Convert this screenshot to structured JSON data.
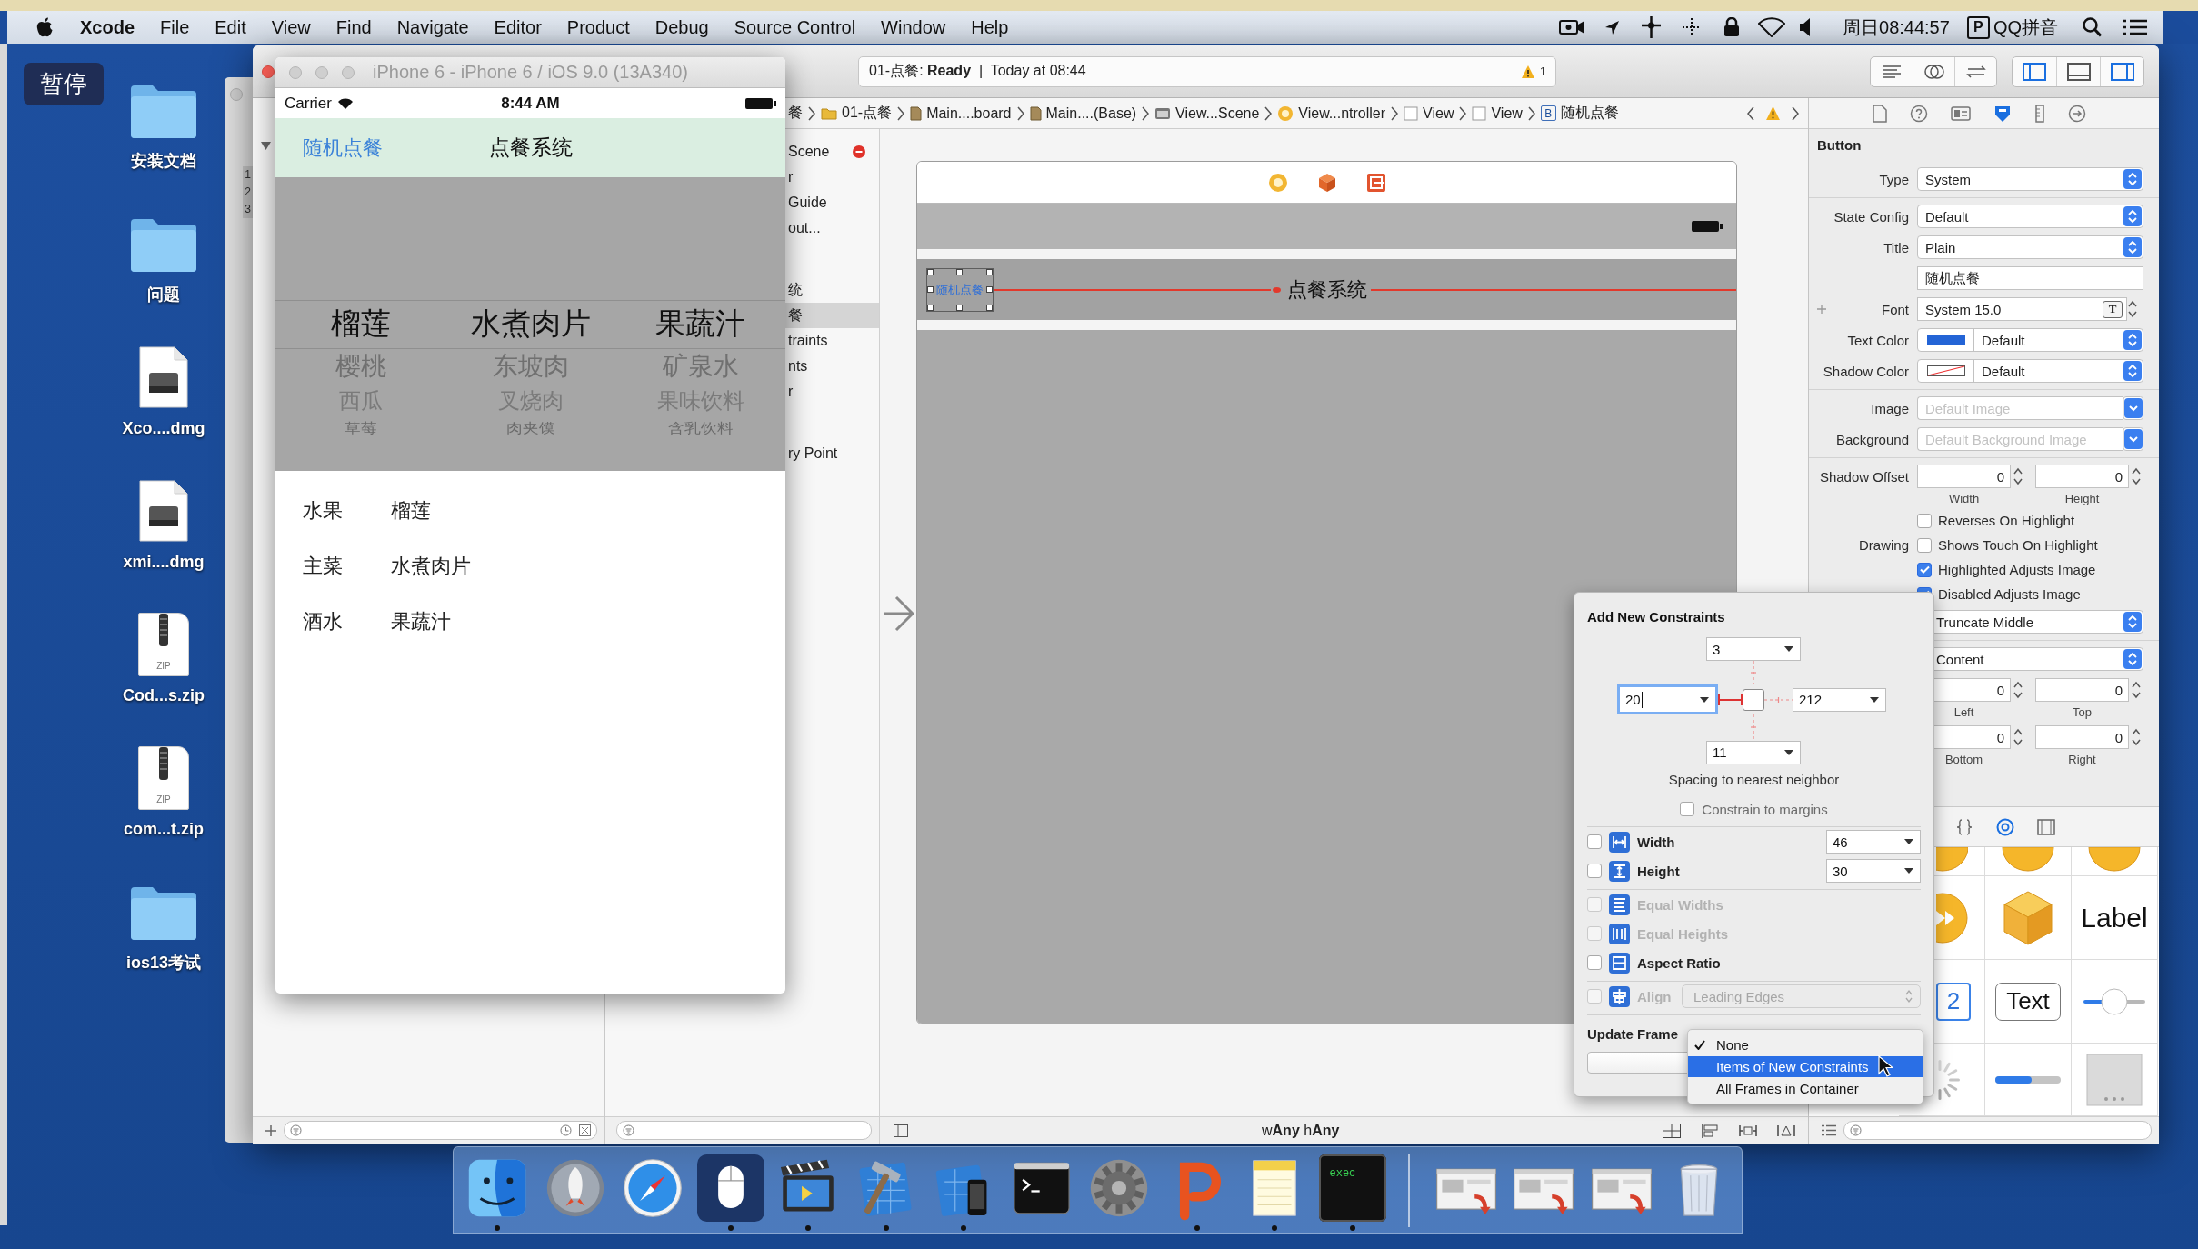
{
  "menu_bar": {
    "app": "Xcode",
    "items": [
      "File",
      "Edit",
      "View",
      "Find",
      "Navigate",
      "Editor",
      "Product",
      "Debug",
      "Source Control",
      "Window",
      "Help"
    ],
    "clock": "周日08:44:57",
    "input_key": "P",
    "input_method": "QQ拼音"
  },
  "pause_badge": "暂停",
  "desktop_icons": [
    {
      "kind": "folder",
      "label": "安装文档"
    },
    {
      "kind": "folder",
      "label": "问题"
    },
    {
      "kind": "disk-image",
      "label": "Xco....dmg"
    },
    {
      "kind": "disk-image",
      "label": "xmi....dmg"
    },
    {
      "kind": "zip",
      "label": "Cod...s.zip",
      "tag": "ZIP"
    },
    {
      "kind": "zip",
      "label": "com...t.zip",
      "tag": "ZIP"
    },
    {
      "kind": "folder",
      "label": "ios13考试"
    }
  ],
  "background_window": {
    "line_numbers": [
      "1",
      "2",
      "3"
    ]
  },
  "simulator": {
    "title": "iPhone 6 - iPhone 6 / iOS 9.0 (13A340)",
    "carrier": "Carrier",
    "time": "8:44 AM",
    "nav_button": "随机点餐",
    "nav_title": "点餐系统",
    "picker": [
      {
        "rows": [
          {
            "label": "榴莲",
            "selected": true
          },
          {
            "label": "樱桃",
            "selected": false
          },
          {
            "label": "西瓜",
            "selected": false
          },
          {
            "label": "草莓",
            "selected": false
          }
        ]
      },
      {
        "rows": [
          {
            "label": "水煮肉片",
            "selected": true
          },
          {
            "label": "东坡肉",
            "selected": false
          },
          {
            "label": "叉烧肉",
            "selected": false
          },
          {
            "label": "肉夹馍",
            "selected": false
          }
        ]
      },
      {
        "rows": [
          {
            "label": "果蔬汁",
            "selected": true
          },
          {
            "label": "矿泉水",
            "selected": false
          },
          {
            "label": "果味饮料",
            "selected": false
          },
          {
            "label": "含乳饮料",
            "selected": false
          }
        ]
      }
    ],
    "results": [
      {
        "category": "水果",
        "choice": "榴莲"
      },
      {
        "category": "主菜",
        "choice": "水煮肉片"
      },
      {
        "category": "酒水",
        "choice": "果蔬汁"
      }
    ]
  },
  "xcode": {
    "status": "01-点餐: **Ready**  |  Today at 08:44",
    "warning_count": "1",
    "view_toggles": [
      {
        "kind": "navigator",
        "on": true
      },
      {
        "kind": "debug",
        "on": false
      },
      {
        "kind": "utilities",
        "on": true
      }
    ],
    "breadcrumb": [
      {
        "kind": "text",
        "label": "餐"
      },
      {
        "kind": "folder",
        "label": "01-点餐"
      },
      {
        "kind": "storyboard",
        "label": "Main....board"
      },
      {
        "kind": "storyboard",
        "label": "Main....(Base)"
      },
      {
        "kind": "scene",
        "label": "View...Scene"
      },
      {
        "kind": "controller",
        "label": "View...ntroller"
      },
      {
        "kind": "view",
        "label": "View"
      },
      {
        "kind": "view",
        "label": "View"
      },
      {
        "kind": "button",
        "badge": "B",
        "label": "随机点餐"
      }
    ],
    "outline": [
      {
        "items": [
          {
            "label": "Scene",
            "error": true,
            "selected": false
          },
          {
            "label": "r",
            "error": false,
            "selected": false
          },
          {
            "label": "Guide",
            "error": false,
            "selected": false
          },
          {
            "label": "out...",
            "error": false,
            "selected": false
          }
        ]
      },
      {
        "items": [
          {
            "label": "统",
            "error": false,
            "selected": false
          },
          {
            "label": "餐",
            "error": false,
            "selected": true
          },
          {
            "label": "traints",
            "error": false,
            "selected": false
          },
          {
            "label": "nts",
            "error": false,
            "selected": false
          },
          {
            "label": "r",
            "error": false,
            "selected": false
          }
        ]
      },
      {
        "items": [
          {
            "label": "ry Point",
            "error": false,
            "selected": false
          }
        ]
      }
    ],
    "canvas": {
      "button_label": "随机点餐",
      "button_selected": true,
      "title_label": "点餐系统",
      "size_class": "w**Any** h**Any**"
    },
    "inspector": {
      "tabs": [
        {
          "kind": "file",
          "selected": false
        },
        {
          "kind": "help",
          "selected": false
        },
        {
          "kind": "identity",
          "selected": false
        },
        {
          "kind": "attributes",
          "selected": true
        },
        {
          "kind": "size",
          "selected": false
        },
        {
          "kind": "connections",
          "selected": false
        }
      ],
      "section": "Button",
      "groups": [
        [
          {
            "kind": "popup",
            "label": "Type",
            "value": "System"
          }
        ],
        [
          {
            "kind": "popup",
            "label": "State Config",
            "value": "Default"
          },
          {
            "kind": "popup",
            "label": "Title",
            "value": "Plain"
          },
          {
            "kind": "text",
            "value": "随机点餐"
          },
          {
            "kind": "font",
            "label": "Font",
            "value": "System 15.0",
            "button": "T"
          },
          {
            "kind": "color",
            "label": "Text Color",
            "value": "Default",
            "color": "#2364d6"
          },
          {
            "kind": "clear-color",
            "label": "Shadow Color",
            "value": "Default"
          }
        ],
        [
          {
            "kind": "combo",
            "label": "Image",
            "placeholder": "Default Image"
          },
          {
            "kind": "combo",
            "label": "Background",
            "placeholder": "Default Background Image"
          }
        ],
        [
          {
            "kind": "pair",
            "label": "Shadow Offset",
            "fields": [
              {
                "value": "0",
                "caption": "Width"
              },
              {
                "value": "0",
                "caption": "Height"
              }
            ]
          },
          {
            "kind": "check",
            "text": "Reverses On Highlight",
            "checked": false
          },
          {
            "kind": "check",
            "label": "Drawing",
            "text": "Shows Touch On Highlight",
            "checked": false
          },
          {
            "kind": "check",
            "text": "Highlighted Adjusts Image",
            "checked": true
          },
          {
            "kind": "check",
            "text": "Disabled Adjusts Image",
            "checked": true
          },
          {
            "kind": "popup",
            "value": "Truncate Middle"
          }
        ],
        [
          {
            "kind": "popup",
            "value": "Content"
          },
          {
            "kind": "pair",
            "fields": [
              {
                "value": "0",
                "caption": "Left"
              },
              {
                "value": "0",
                "caption": "Top"
              }
            ]
          },
          {
            "kind": "pair",
            "fields": [
              {
                "value": "0",
                "caption": "Bottom"
              },
              {
                "value": "0",
                "caption": "Right"
              }
            ]
          }
        ]
      ]
    },
    "library": {
      "tabs": [
        {
          "kind": "snippets",
          "selected": false
        },
        {
          "kind": "objects",
          "selected": true
        },
        {
          "kind": "media",
          "selected": false
        }
      ],
      "items": [
        {
          "kind": "half-circle"
        },
        {
          "kind": "half-circle"
        },
        {
          "kind": "half-circle"
        },
        {
          "kind": "media-circle"
        },
        {
          "kind": "cube"
        },
        {
          "kind": "label",
          "text": "Label"
        },
        {
          "kind": "number",
          "text": "2"
        },
        {
          "kind": "text-field",
          "text": "Text"
        },
        {
          "kind": "slider"
        },
        {
          "kind": "spinner"
        },
        {
          "kind": "progress"
        },
        {
          "kind": "image"
        }
      ]
    }
  },
  "constraints": {
    "title": "Add New Constraints",
    "spacing": {
      "top": {
        "value": "3",
        "active": false,
        "focused": false
      },
      "left": {
        "value": "20",
        "active": true,
        "focused": true
      },
      "right": {
        "value": "212",
        "active": false,
        "focused": false
      },
      "bottom": {
        "value": "11",
        "active": false,
        "focused": false
      }
    },
    "caption": "Spacing to nearest neighbor",
    "margins": {
      "text": "Constrain to margins",
      "checked": false
    },
    "row_groups": [
      [
        {
          "kind": "width",
          "text": "Width",
          "value": "46",
          "checked": false,
          "disabled": false
        },
        {
          "kind": "height",
          "text": "Height",
          "value": "30",
          "checked": false,
          "disabled": false
        }
      ],
      [
        {
          "kind": "equal-widths",
          "text": "Equal Widths",
          "checked": false,
          "disabled": true
        },
        {
          "kind": "equal-heights",
          "text": "Equal Heights",
          "checked": false,
          "disabled": true
        },
        {
          "kind": "aspect-ratio",
          "text": "Aspect Ratio",
          "checked": false,
          "disabled": false
        }
      ],
      [
        {
          "kind": "align",
          "text": "Align",
          "value": "Leading Edges",
          "checked": false,
          "disabled": true
        }
      ]
    ],
    "update_label": "Update Frame",
    "menu": [
      {
        "text": "None",
        "checked": true,
        "selected": false
      },
      {
        "text": "Items of New Constraints",
        "checked": false,
        "selected": true
      },
      {
        "text": "All Frames in Container",
        "checked": false,
        "selected": false
      }
    ]
  },
  "dock": {
    "apps": [
      {
        "kind": "face",
        "running": true,
        "highlighted": false
      },
      {
        "kind": "rocket",
        "running": false,
        "highlighted": false
      },
      {
        "kind": "compass",
        "running": false,
        "highlighted": false
      },
      {
        "kind": "mouse",
        "running": true,
        "highlighted": true
      },
      {
        "kind": "clapper",
        "running": true,
        "highlighted": false
      },
      {
        "kind": "hammer",
        "running": true,
        "highlighted": false
      },
      {
        "kind": "phone-blueprint",
        "running": true,
        "highlighted": false
      },
      {
        "kind": "terminal",
        "running": false,
        "highlighted": false
      },
      {
        "kind": "gear",
        "running": false,
        "highlighted": false
      },
      {
        "kind": "letter-p",
        "running": true,
        "highlighted": false
      },
      {
        "kind": "notepad",
        "running": true,
        "highlighted": false
      },
      {
        "kind": "labelled-terminal",
        "label": "exec",
        "running": true,
        "highlighted": false
      }
    ],
    "documents": [
      {
        "kind": "window"
      },
      {
        "kind": "window"
      },
      {
        "kind": "window"
      },
      {
        "kind": "trash"
      }
    ]
  }
}
